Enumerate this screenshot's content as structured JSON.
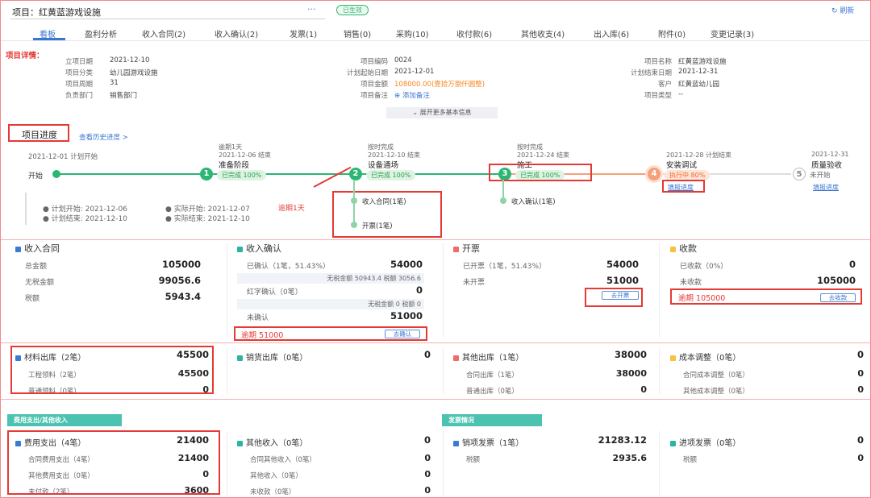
{
  "header": {
    "title": "项目：红黄蓝游戏设施",
    "more": "···",
    "status": "已生效",
    "refresh": "刷新"
  },
  "tabs": [
    "看板",
    "盈利分析",
    "收入合同(2)",
    "收入确认(2)",
    "发票(1)",
    "销售(0)",
    "采购(10)",
    "收付款(6)",
    "其他收支(4)",
    "出入库(6)",
    "附件(0)",
    "变更记录(3)"
  ],
  "detail": {
    "heading": "项目详情：",
    "col1": [
      [
        "立项日期",
        "2021-12-10"
      ],
      [
        "项目分类",
        "幼儿园游戏设施"
      ],
      [
        "项目周期",
        "31"
      ],
      [
        "负责部门",
        "销售部门"
      ]
    ],
    "col2": [
      [
        "项目编码",
        "0024"
      ],
      [
        "计划起始日期",
        "2021-12-01"
      ],
      [
        "项目金额",
        "108000.00(壹拾万捌仟圆整)"
      ],
      [
        "项目备注",
        "添加备注"
      ]
    ],
    "col3": [
      [
        "项目名称",
        "红黄蓝游戏设施"
      ],
      [
        "计划结束日期",
        "2021-12-31"
      ],
      [
        "客户",
        "红黄蓝幼儿园"
      ],
      [
        "项目类型",
        "--"
      ]
    ],
    "expand": "展开更多基本信息"
  },
  "progress": {
    "heading": "项目进度",
    "history": "查看历史进度 >",
    "start_date": "2021-12-01 计划开始",
    "start_label": "开始",
    "steps": [
      {
        "n": "1",
        "note": "逾期1天",
        "date": "2021-12-06 结束",
        "name": "准备阶段",
        "status": "已完成",
        "pct": "100%"
      },
      {
        "n": "2",
        "note": "按时完成",
        "date": "2021-12-10 结束",
        "name": "设备通场",
        "status": "已完成",
        "pct": "100%"
      },
      {
        "n": "3",
        "note": "按时完成",
        "date": "2021-12-24 结束",
        "name": "施工",
        "status": "已完成",
        "pct": "100%"
      },
      {
        "n": "4",
        "note": "",
        "date": "2021-12-28 计划结束",
        "name": "安装调试",
        "status": "执行中",
        "pct": "80%",
        "link": "填报进度"
      },
      {
        "n": "5",
        "note": "",
        "date": "2021-12-31",
        "name": "质量验收",
        "status": "未开始",
        "pct": "",
        "link": "填报进度"
      }
    ],
    "plan_start": "计划开始: 2021-12-06",
    "plan_end": "计划结束: 2021-12-10",
    "actual_start": "实际开始: 2021-12-07",
    "actual_end": "实际结束: 2021-12-10",
    "overdue": "逾期1天",
    "sub2": [
      "收入合同(1笔)",
      "开票(1笔)"
    ],
    "sub3": [
      "收入确认(1笔)"
    ]
  },
  "colors": {
    "blue": "#3a7bd5",
    "green": "#2bb673",
    "teal": "#2bb5a0",
    "orange": "#f5a623",
    "red": "#e53935",
    "pink": "#f06a6a",
    "yellow": "#f7c23d"
  },
  "cards1": [
    {
      "title": "收入合同",
      "icon": "blue",
      "rows": [
        [
          "总金额",
          "105000"
        ],
        [
          "无税金额",
          "99056.6"
        ],
        [
          "税额",
          "5943.4"
        ]
      ]
    },
    {
      "title": "收入确认",
      "icon": "teal",
      "rows": [
        [
          "已确认（1笔，51.43%）",
          "54000"
        ],
        [
          "红字确认（0笔）",
          "0"
        ],
        [
          "未确认",
          "51000"
        ]
      ],
      "subs": [
        "无税金额 50943.4 税额 3056.6",
        "无税金额 0 税额 0"
      ],
      "overdue": "逾期 51000",
      "btn": "去确认"
    },
    {
      "title": "开票",
      "icon": "pink",
      "rows": [
        [
          "已开票（1笔，51.43%）",
          "54000"
        ],
        [
          "未开票",
          "51000"
        ]
      ],
      "btn": "去开票"
    },
    {
      "title": "收款",
      "icon": "yellow",
      "rows": [
        [
          "已收款（0%）",
          "0"
        ],
        [
          "未收款",
          "105000"
        ]
      ],
      "overdue": "逾期 105000",
      "btn": "去收款"
    }
  ],
  "cards2": [
    {
      "title": "材料出库（2笔）",
      "value": "45500",
      "icon": "blue",
      "rows": [
        [
          "工程领料（2笔）",
          "45500"
        ],
        [
          "普通领料（0笔）",
          "0"
        ]
      ]
    },
    {
      "title": "销货出库（0笔）",
      "value": "0",
      "icon": "teal",
      "rows": []
    },
    {
      "title": "其他出库（1笔）",
      "value": "38000",
      "icon": "pink",
      "rows": [
        [
          "合同出库（1笔）",
          "38000"
        ],
        [
          "普通出库（0笔）",
          "0"
        ]
      ]
    },
    {
      "title": "成本调整（0笔）",
      "value": "0",
      "icon": "yellow",
      "rows": [
        [
          "合同成本调整（0笔）",
          "0"
        ],
        [
          "其他成本调整（0笔）",
          "0"
        ]
      ]
    }
  ],
  "ribbons": [
    "费用支出/其他收入",
    "发票情况"
  ],
  "cards3": [
    {
      "title": "费用支出（4笔）",
      "value": "21400",
      "icon": "blue",
      "rows": [
        [
          "合同费用支出（4笔）",
          "21400"
        ],
        [
          "其他费用支出（0笔）",
          "0"
        ],
        [
          "未付款（2笔）",
          "3600"
        ]
      ]
    },
    {
      "title": "其他收入（0笔）",
      "value": "0",
      "icon": "teal",
      "rows": [
        [
          "合同其他收入（0笔）",
          "0"
        ],
        [
          "其他收入（0笔）",
          "0"
        ],
        [
          "未收款（0笔）",
          "0"
        ]
      ]
    },
    {
      "title": "销项发票（1笔）",
      "value": "21283.12",
      "icon": "blue",
      "rows": [
        [
          "税额",
          "2935.6"
        ]
      ]
    },
    {
      "title": "进项发票（0笔）",
      "value": "0",
      "icon": "teal",
      "rows": [
        [
          "税额",
          "0"
        ]
      ]
    }
  ]
}
